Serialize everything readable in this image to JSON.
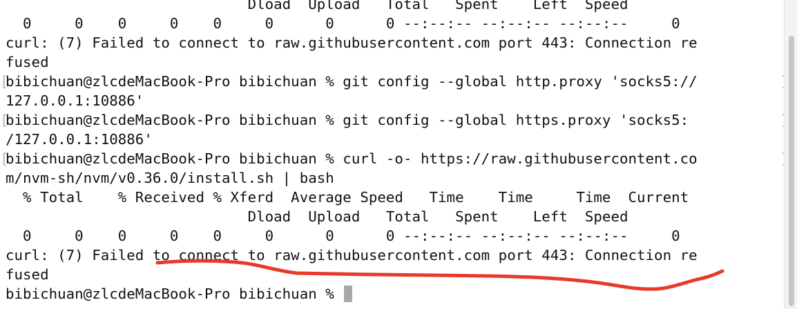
{
  "terminal": {
    "lines": [
      {
        "text": "                            Dload  Upload   Total   Spent    Left  Speed"
      },
      {
        "text": "  0     0    0     0    0     0      0      0 --:--:-- --:--:-- --:--:--     0"
      },
      {
        "text": "curl: (7) Failed to connect to raw.githubusercontent.com port 443: Connection re"
      },
      {
        "text": "fused"
      },
      {
        "text": "bibichuan@zlcdeMacBook-Pro bibichuan % git config --global http.proxy 'socks5://",
        "bracket_left": "[",
        "bracket_right": "]"
      },
      {
        "text": "127.0.0.1:10886'"
      },
      {
        "text": "bibichuan@zlcdeMacBook-Pro bibichuan % git config --global https.proxy 'socks5: ",
        "bracket_left": "[",
        "bracket_right": "]"
      },
      {
        "text": "/127.0.0.1:10886'"
      },
      {
        "text": "bibichuan@zlcdeMacBook-Pro bibichuan % curl -o- https://raw.githubusercontent.co",
        "bracket_left": "[",
        "bracket_right": "]"
      },
      {
        "text": "m/nvm-sh/nvm/v0.36.0/install.sh | bash"
      },
      {
        "text": "  % Total    % Received % Xferd  Average Speed   Time    Time     Time  Current"
      },
      {
        "text": "                            Dload  Upload   Total   Spent    Left  Speed"
      },
      {
        "text": "  0     0    0     0    0     0      0      0 --:--:-- --:--:-- --:--:--     0"
      },
      {
        "text": "curl: (7) Failed to connect to raw.githubusercontent.com port 443: Connection re"
      },
      {
        "text": "fused"
      },
      {
        "text": "bibichuan@zlcdeMacBook-Pro bibichuan % "
      }
    ]
  },
  "colors": {
    "background": "#ffffff",
    "text": "#111111",
    "annotation_stroke": "#e8392a",
    "cursor": "#a8a8a8"
  },
  "annotation": {
    "type": "freehand-underline",
    "icon": "red-underline-mark"
  }
}
